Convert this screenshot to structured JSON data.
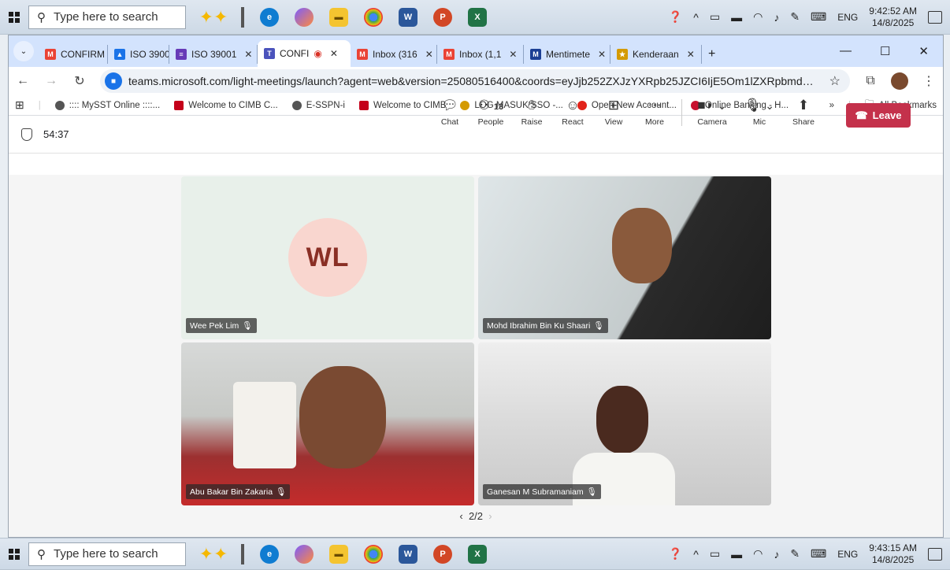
{
  "taskbar_top": {
    "search_placeholder": "Type here to search",
    "time": "9:42:52 AM",
    "date": "14/8/2025",
    "lang": "ENG"
  },
  "taskbar_bottom": {
    "search_placeholder": "Type here to search",
    "time": "9:43:15 AM",
    "date": "14/8/2025",
    "lang": "ENG"
  },
  "tabs": [
    {
      "label": "CONFIRM",
      "icon": "gmail-icon",
      "color": "#ea4335"
    },
    {
      "label": "ISO 39001",
      "icon": "drive-icon",
      "color": "#1a73e8"
    },
    {
      "label": "ISO 39001",
      "icon": "forms-icon",
      "color": "#673ab7"
    },
    {
      "label": "CONFI",
      "icon": "teams-icon",
      "color": "#4b53bc"
    },
    {
      "label": "Inbox (316",
      "icon": "gmail-icon",
      "color": "#ea4335"
    },
    {
      "label": "Inbox (1,1",
      "icon": "gmail-icon",
      "color": "#ea4335"
    },
    {
      "label": "Mentimete",
      "icon": "mentimeter-icon",
      "color": "#1c3f94"
    },
    {
      "label": "Kenderaan",
      "icon": "crest-icon",
      "color": "#d49a00"
    }
  ],
  "url": "teams.microsoft.com/light-meetings/launch?agent=web&version=25080516400&coords=eyJjb252ZXJzYXRpb25JZCI6IjE5Om1lZXRpbmdfTjJOaFpES...",
  "bookmarks": [
    {
      "label": ":::: MySST Online ::::...",
      "color": "#555"
    },
    {
      "label": "Welcome to CIMB C...",
      "color": "#c4001a"
    },
    {
      "label": "E-SSPN-i",
      "color": "#555"
    },
    {
      "label": "Welcome to CIMB",
      "color": "#c4001a"
    },
    {
      "label": "LOG MASUK SSO -...",
      "color": "#d49a00"
    },
    {
      "label": "Open New Account...",
      "color": "#e2231a"
    },
    {
      "label": "Online Banking - H...",
      "color": "#c8102e"
    }
  ],
  "bookmarks_all": "All Bookmarks",
  "meeting": {
    "timer": "54:37",
    "controls": {
      "chat": "Chat",
      "people": "People",
      "people_count": "13",
      "raise": "Raise",
      "react": "React",
      "view": "View",
      "more": "More",
      "camera": "Camera",
      "mic": "Mic",
      "share": "Share"
    },
    "leave": "Leave",
    "participants": [
      {
        "name": "Wee Pek Lim",
        "initials": "WL"
      },
      {
        "name": "Mohd Ibrahim Bin Ku Shaari"
      },
      {
        "name": "Abu Bakar Bin Zakaria"
      },
      {
        "name": "Ganesan M Subramaniam"
      }
    ],
    "page": "2/2"
  }
}
